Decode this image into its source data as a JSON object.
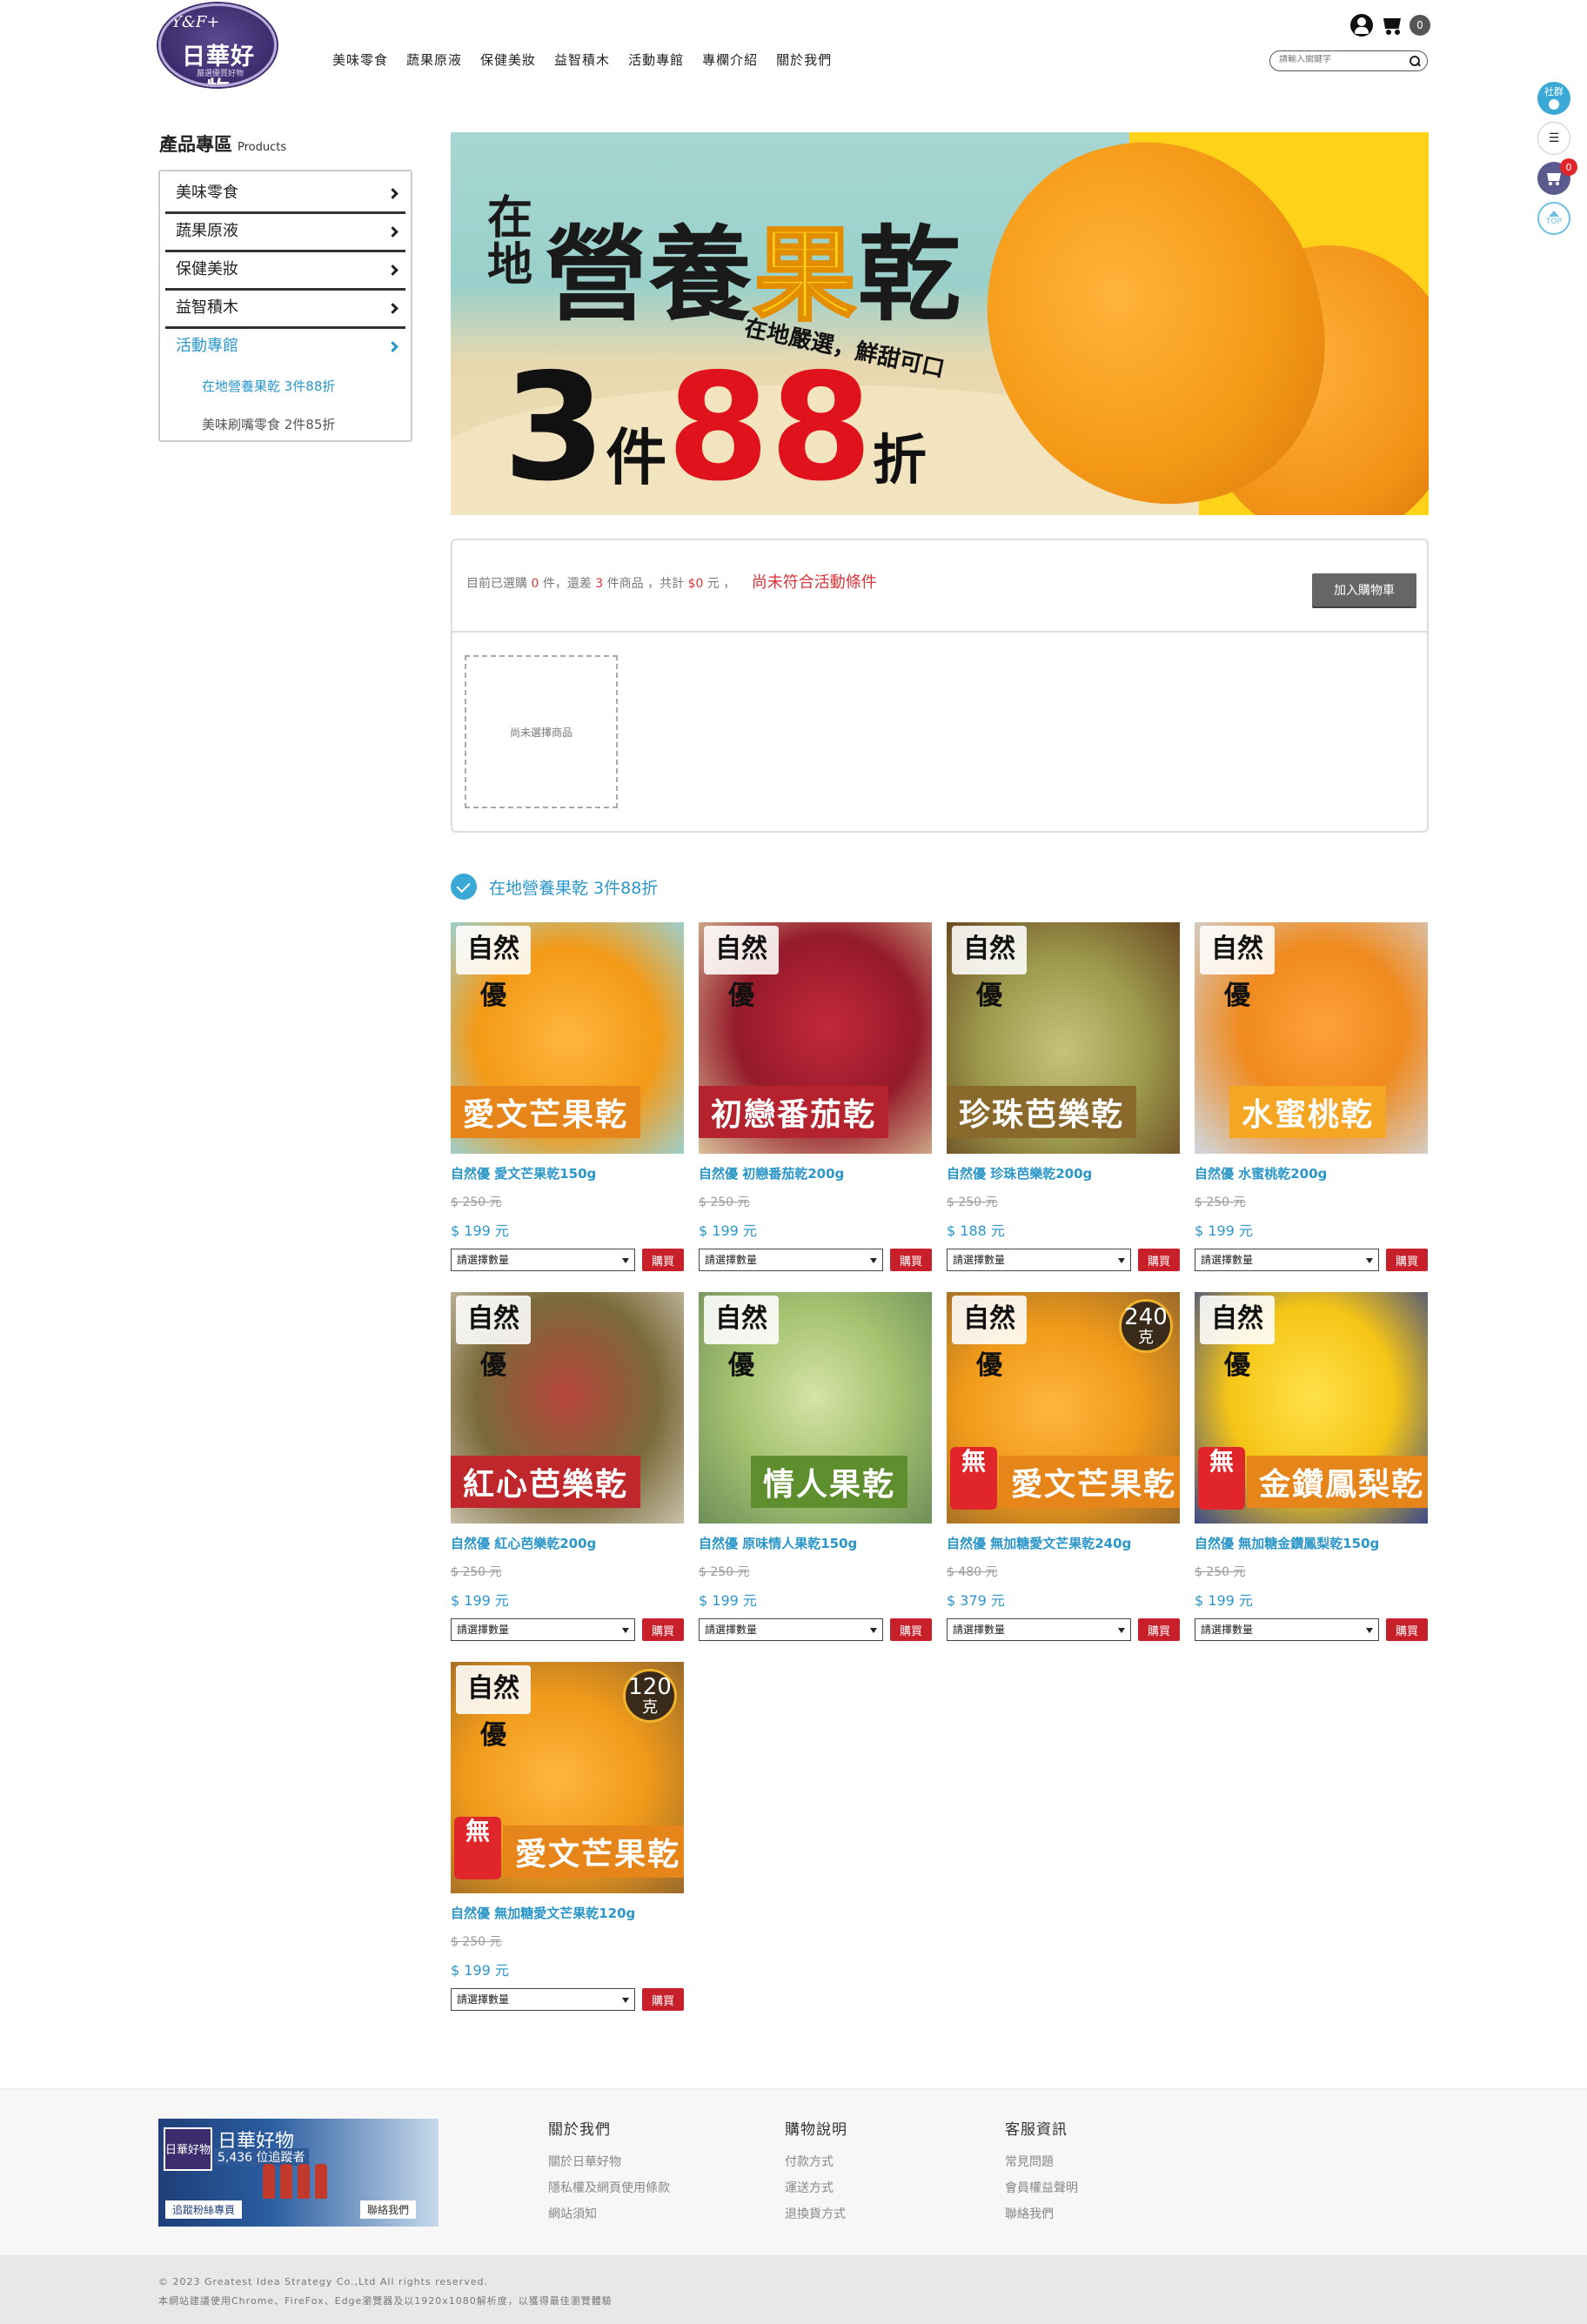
{
  "header": {
    "logo": {
      "mark": "Y&F+",
      "name": "日華好物",
      "sub": "嚴選優質好物"
    },
    "nav": [
      "美味零食",
      "蔬果原液",
      "保健美妝",
      "益智積木",
      "活動專館",
      "專欄介紹",
      "關於我們"
    ],
    "cart_count": "0",
    "search_placeholder": "請輸入關鍵字"
  },
  "floating": {
    "social": "社群",
    "cart_badge": "0",
    "top": "TOP"
  },
  "sidebar": {
    "title": "產品專區",
    "title_en": "Products",
    "items": [
      "美味零食",
      "蔬果原液",
      "保健美妝",
      "益智積木",
      "活動專館"
    ],
    "subitems": [
      "在地營養果乾 3件88折",
      "美味刷嘴零食 2件85折"
    ]
  },
  "banner": {
    "local": "在地",
    "title_a": "營養",
    "title_hl": "果",
    "title_b": "乾",
    "sub": "在地嚴選，鮮甜可口",
    "deal_num": "3",
    "deal_unit": "件",
    "deal_rate": "88",
    "deal_suffix": "折"
  },
  "promo": {
    "s1": "目前已選購",
    "selected": "0",
    "s2": "件，還差",
    "remain": "3",
    "s3": "件商品 ，共計",
    "total": "$0",
    "s4": "元 ，",
    "warn": "尚未符合活動條件",
    "add_cart": "加入購物車",
    "empty": "尚未選擇商品"
  },
  "section": {
    "title": "在地營養果乾 3件88折"
  },
  "products": [
    {
      "name": "自然優 愛文芒果乾150g",
      "old": "$ 250 元",
      "price": "$ 199 元",
      "label": "愛文芒果乾",
      "brand": "自然優"
    },
    {
      "name": "自然優 初戀番茄乾200g",
      "old": "$ 250 元",
      "price": "$ 199 元",
      "label": "初戀番茄乾",
      "brand": "自然優"
    },
    {
      "name": "自然優 珍珠芭樂乾200g",
      "old": "$ 250 元",
      "price": "$ 188 元",
      "label": "珍珠芭樂乾",
      "brand": "自然優"
    },
    {
      "name": "自然優 水蜜桃乾200g",
      "old": "$ 250 元",
      "price": "$ 199 元",
      "label": "水蜜桃乾",
      "brand": "自然優"
    },
    {
      "name": "自然優 紅心芭樂乾200g",
      "old": "$ 250 元",
      "price": "$ 199 元",
      "label": "紅心芭樂乾",
      "brand": "自然優"
    },
    {
      "name": "自然優 原味情人果乾150g",
      "old": "$ 250 元",
      "price": "$ 199 元",
      "label": "情人果乾",
      "brand": "自然優"
    },
    {
      "name": "自然優 無加糖愛文芒果乾240g",
      "old": "$ 480 元",
      "price": "$ 379 元",
      "label": "愛文芒果乾",
      "brand": "自然優",
      "weight": "240",
      "weight_unit": "克"
    },
    {
      "name": "自然優 無加糖金鑽鳳梨乾150g",
      "old": "$ 250 元",
      "price": "$ 199 元",
      "label": "金鑽鳳梨乾",
      "brand": "自然優"
    },
    {
      "name": "自然優 無加糖愛文芒果乾120g",
      "old": "$ 250 元",
      "price": "$ 199 元",
      "label": "愛文芒果乾",
      "brand": "自然優",
      "weight": "120",
      "weight_unit": "克"
    }
  ],
  "buy_controls": {
    "qty_placeholder": "請選擇數量",
    "buy": "購買"
  },
  "footer": {
    "banner": {
      "title": "日華好物",
      "subtitle": "5,436 位追蹤者",
      "fan": "追蹤粉絲專頁",
      "contact": "聯絡我們"
    },
    "cols": [
      {
        "title": "關於我們",
        "links": [
          "關於日華好物",
          "隱私權及網頁使用條款",
          "網站須知"
        ]
      },
      {
        "title": "購物說明",
        "links": [
          "付款方式",
          "運送方式",
          "退換貨方式"
        ]
      },
      {
        "title": "客服資訊",
        "links": [
          "常見問題",
          "會員權益聲明",
          "聯絡我們"
        ]
      }
    ],
    "copyright": "© 2023 Greatest Idea Strategy Co.,Ltd All rights reserved.",
    "note": "本網站建議使用Chrome、FireFox、Edge瀏覽器及以1920x1080解析度，以獲得最佳瀏覽體驗"
  },
  "colors": {
    "accent": "#2b96c8",
    "sale": "#c8202a",
    "brand": "#3c2d6e"
  }
}
